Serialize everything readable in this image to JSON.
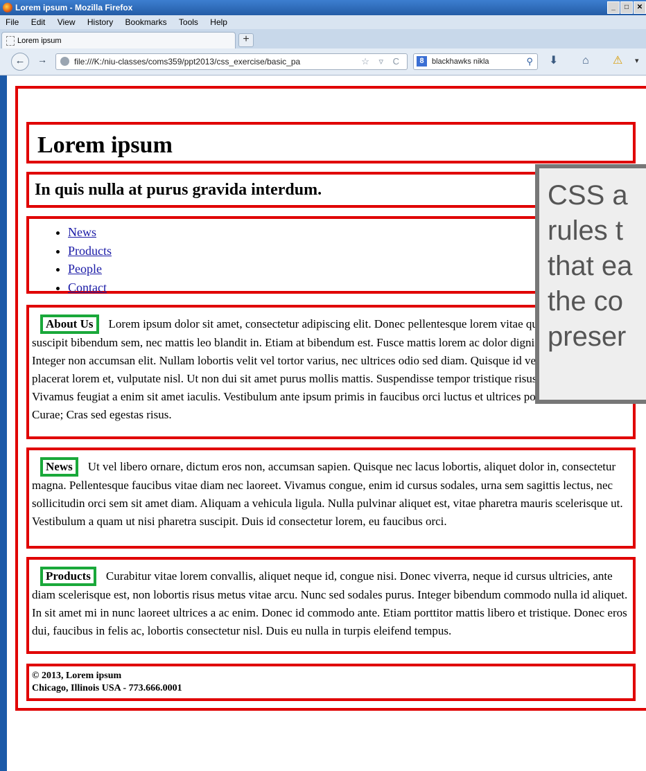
{
  "window": {
    "title": "Lorem ipsum - Mozilla Firefox",
    "buttons": [
      "_",
      "□",
      "✕"
    ]
  },
  "menu": [
    "File",
    "Edit",
    "View",
    "History",
    "Bookmarks",
    "Tools",
    "Help"
  ],
  "tab": {
    "label": "Lorem ipsum",
    "new_tab": "+"
  },
  "nav": {
    "back": "←",
    "forward": "→",
    "url": "file:///K:/niu-classes/coms359/ppt2013/css_exercise/basic_pa",
    "url_icons": "☆ ▿ C",
    "search_text": "blackhawks nikla",
    "search_engine": "8"
  },
  "toolbar_icons": {
    "download": "⬇",
    "home": "⌂",
    "warning": "⚠",
    "more": "▾"
  },
  "page": {
    "title": "Lorem ipsum",
    "subtitle": "In quis nulla at purus gravida interdum.",
    "links": [
      "News",
      "Products",
      "People",
      "Contact"
    ],
    "sections": [
      {
        "heading": "About Us",
        "text": "Lorem ipsum dolor sit amet, consectetur adipiscing elit. Donec pellentesque lorem vitae quam viverra. Ut suscipit bibendum sem, nec mattis leo blandit in. Etiam at bibendum est. Fusce mattis lorem ac dolor dignissim consectetur. Integer non accumsan elit. Nullam lobortis velit vel tortor varius, nec ultrices odio sed diam. Quisque id velit molestie, placerat lorem et, vulputate nisl. Ut non dui sit amet purus mollis mattis. Suspendisse tempor tristique risus eget semper. Vivamus feugiat a enim sit amet iaculis. Vestibulum ante ipsum primis in faucibus orci luctus et ultrices posuere cubilia Curae; Cras sed egestas risus."
      },
      {
        "heading": "News",
        "text": "Ut vel libero ornare, dictum eros non, accumsan sapien. Quisque nec lacus lobortis, aliquet dolor in, consectetur magna. Pellentesque faucibus vitae diam nec laoreet. Vivamus congue, enim id cursus sodales, urna sem sagittis lectus, nec sollicitudin orci sem sit amet diam. Aliquam a vehicula ligula. Nulla pulvinar aliquet est, vitae pharetra mauris scelerisque ut. Vestibulum a quam ut nisi pharetra suscipit. Duis id consectetur lorem, eu faucibus orci."
      },
      {
        "heading": "Products",
        "text": "Curabitur vitae lorem convallis, aliquet neque id, congue nisi. Donec viverra, neque id cursus ultricies, ante diam scelerisque est, non lobortis risus metus vitae arcu. Nunc sed sodales purus. Integer bibendum commodo nulla id aliquet. In sit amet mi in nunc laoreet ultrices a ac enim. Donec id commodo ante. Etiam porttitor mattis libero et tristique. Donec eros dui, faucibus in felis ac, lobortis consectetur nisl. Duis eu nulla in turpis eleifend tempus."
      }
    ],
    "footer_line1": "© 2013, Lorem ipsum",
    "footer_line2": "Chicago, Illinois USA - 773.666.0001"
  },
  "callout": {
    "lines": [
      "CSS a",
      "rules t",
      "that ea",
      "the co",
      "preser"
    ]
  },
  "colors": {
    "box_border": "#e00000",
    "heading_border": "#1aa83a",
    "link": "#1a1aa6"
  }
}
